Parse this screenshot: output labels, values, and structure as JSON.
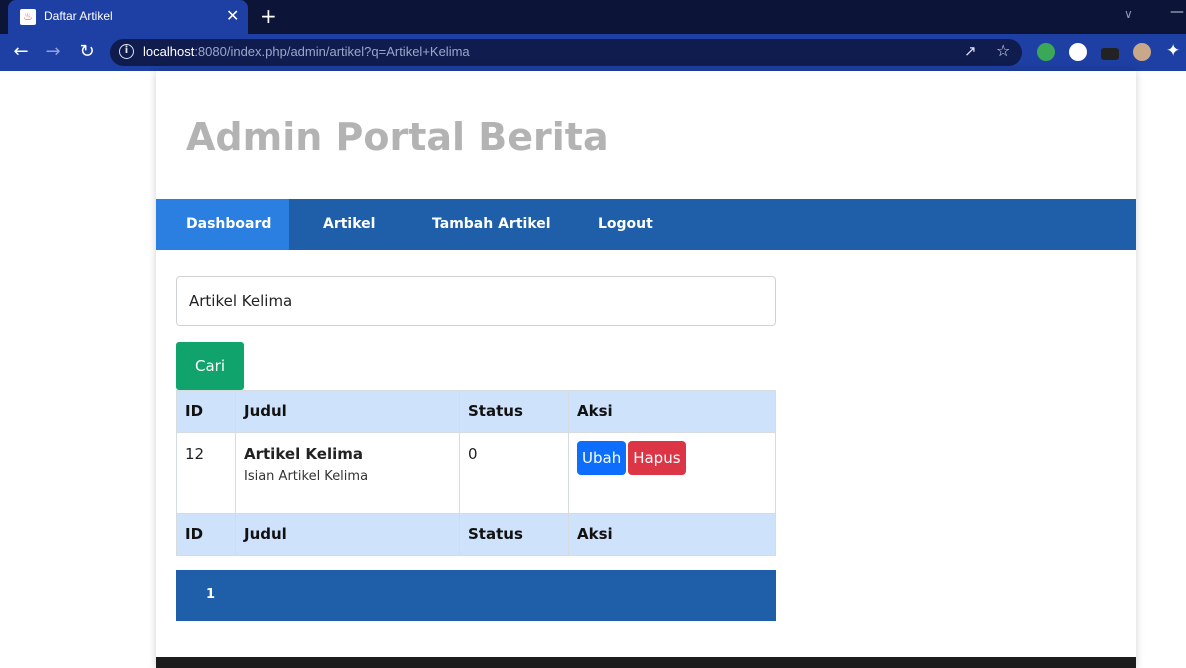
{
  "browser": {
    "tab_title": "Daftar Artikel",
    "tab_close": "✕",
    "new_tab": "+",
    "url_host": "localhost",
    "url_rest": ":8080/index.php/admin/artikel?q=Artikel+Kelima",
    "icons": [
      "back-icon",
      "forward-icon",
      "reload-icon",
      "info-icon",
      "share-icon",
      "star-icon",
      "extensions-icon"
    ]
  },
  "site": {
    "title": "Admin Portal Berita"
  },
  "menu": {
    "items": [
      {
        "label": "Dashboard"
      },
      {
        "label": "Artikel"
      },
      {
        "label": "Tambah Artikel"
      },
      {
        "label": "Logout"
      }
    ]
  },
  "search": {
    "value": "Artikel Kelima",
    "button_label": "Cari"
  },
  "table": {
    "headers": [
      "ID",
      "Judul",
      "Status",
      "Aksi"
    ],
    "rows": [
      {
        "id": "12",
        "title": "Artikel Kelima",
        "description": "Isian Artikel Kelima",
        "status": "0",
        "edit_label": "Ubah",
        "delete_label": "Hapus"
      }
    ]
  },
  "pagination": {
    "current_page": "1"
  },
  "colors": {
    "menu_bg": "#1f5faa",
    "menu_active": "#2a7fe0",
    "search_button": "#11a36c",
    "edit_button": "#0d6efd",
    "delete_button": "#dc3545",
    "table_header": "#cfe2fb"
  }
}
